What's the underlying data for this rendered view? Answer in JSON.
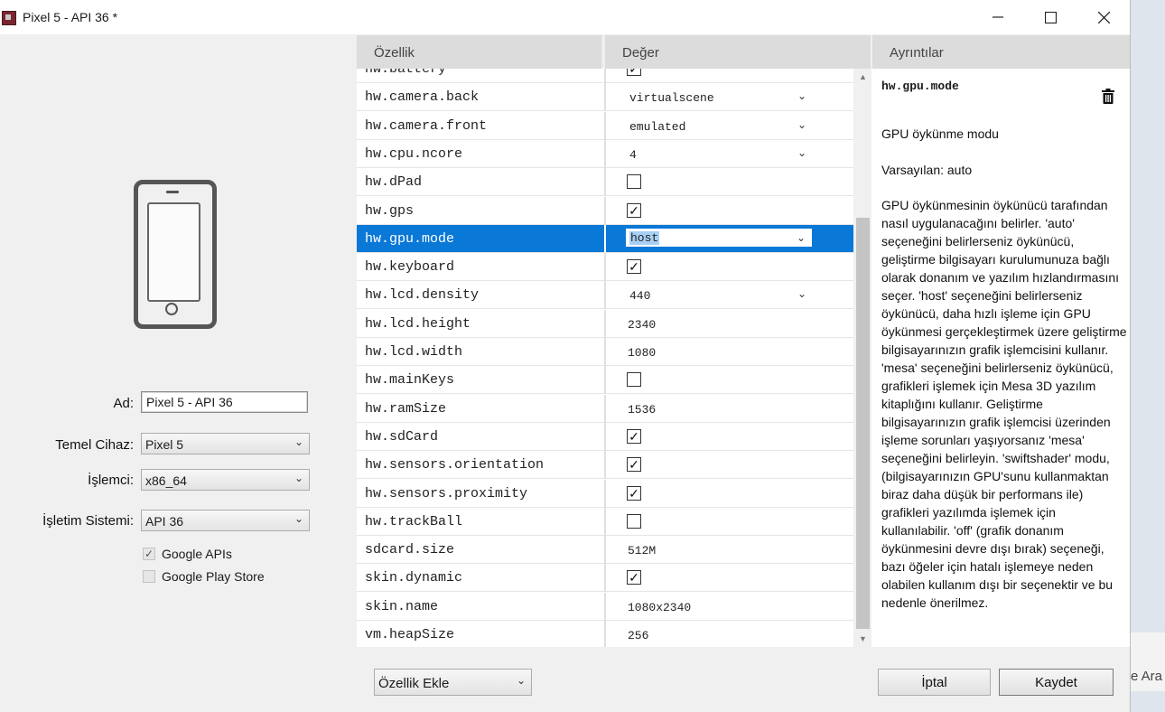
{
  "window": {
    "title": "Pixel 5 - API 36 *"
  },
  "left": {
    "fields": [
      {
        "label": "Ad:",
        "value": "Pixel 5 - API 36"
      },
      {
        "label": "Temel Cihaz:",
        "value": "Pixel 5"
      },
      {
        "label": "İşlemci:",
        "value": "x86_64"
      },
      {
        "label": "İşletim Sistemi:",
        "value": "API 36"
      }
    ],
    "checks": [
      {
        "label": "Google APIs",
        "checked": true
      },
      {
        "label": "Google Play Store",
        "checked": false
      }
    ]
  },
  "grid": {
    "headers": {
      "property": "Özellik",
      "value": "Değer",
      "details": "Ayrıntılar"
    },
    "rows": [
      {
        "name": "hw.battery",
        "type": "check",
        "checked": true
      },
      {
        "name": "hw.camera.back",
        "type": "dropdown",
        "value": "virtualscene"
      },
      {
        "name": "hw.camera.front",
        "type": "dropdown",
        "value": "emulated"
      },
      {
        "name": "hw.cpu.ncore",
        "type": "dropdown",
        "value": "4"
      },
      {
        "name": "hw.dPad",
        "type": "check",
        "checked": false
      },
      {
        "name": "hw.gps",
        "type": "check",
        "checked": true
      },
      {
        "name": "hw.gpu.mode",
        "type": "selected",
        "value": "host"
      },
      {
        "name": "hw.keyboard",
        "type": "check",
        "checked": true
      },
      {
        "name": "hw.lcd.density",
        "type": "dropdown",
        "value": "440"
      },
      {
        "name": "hw.lcd.height",
        "type": "text",
        "value": "2340"
      },
      {
        "name": "hw.lcd.width",
        "type": "text",
        "value": "1080"
      },
      {
        "name": "hw.mainKeys",
        "type": "check",
        "checked": false
      },
      {
        "name": "hw.ramSize",
        "type": "text",
        "value": "1536"
      },
      {
        "name": "hw.sdCard",
        "type": "check",
        "checked": true
      },
      {
        "name": "hw.sensors.orientation",
        "type": "check",
        "checked": true
      },
      {
        "name": "hw.sensors.proximity",
        "type": "check",
        "checked": true
      },
      {
        "name": "hw.trackBall",
        "type": "check",
        "checked": false
      },
      {
        "name": "sdcard.size",
        "type": "text",
        "value": "512M"
      },
      {
        "name": "skin.dynamic",
        "type": "check",
        "checked": true
      },
      {
        "name": "skin.name",
        "type": "text",
        "value": "1080x2340"
      },
      {
        "name": "vm.heapSize",
        "type": "text",
        "value": "256"
      }
    ]
  },
  "details": {
    "title": "hw.gpu.mode",
    "summary": "GPU öykünme modu",
    "default": "Varsayılan: auto",
    "body": "GPU öykünmesinin öykünücü tarafından nasıl uygulanacağını belirler. 'auto' seçeneğini belirlerseniz öykünücü, geliştirme bilgisayarı kurulumunuza bağlı olarak donanım ve yazılım hızlandırmasını seçer. 'host' seçeneğini belirlerseniz öykünücü, daha hızlı işleme için GPU öykünmesi gerçekleştirmek üzere geliştirme bilgisayarınızın grafik işlemcisini kullanır. 'mesa' seçeneğini belirlerseniz öykünücü, grafikleri işlemek için Mesa 3D yazılım kitaplığını kullanır. Geliştirme bilgisayarınızın grafik işlemcisi üzerinden işleme sorunları yaşıyorsanız 'mesa' seçeneğini belirleyin. 'swiftshader' modu, (bilgisayarınızın GPU'sunu kullanmaktan biraz daha düşük bir performans ile) grafikleri yazılımda işlemek için kullanılabilir. 'off' (grafik donanım öykünmesini devre dışı bırak) seçeneği, bazı öğeler için hatalı işlemeye neden olabilen kullanım dışı bir seçenektir ve bu nedenle önerilmez."
  },
  "footer": {
    "add_property": "Özellik Ekle",
    "cancel": "İptal",
    "save": "Kaydet"
  },
  "background": {
    "partial_text": "e Ara"
  }
}
